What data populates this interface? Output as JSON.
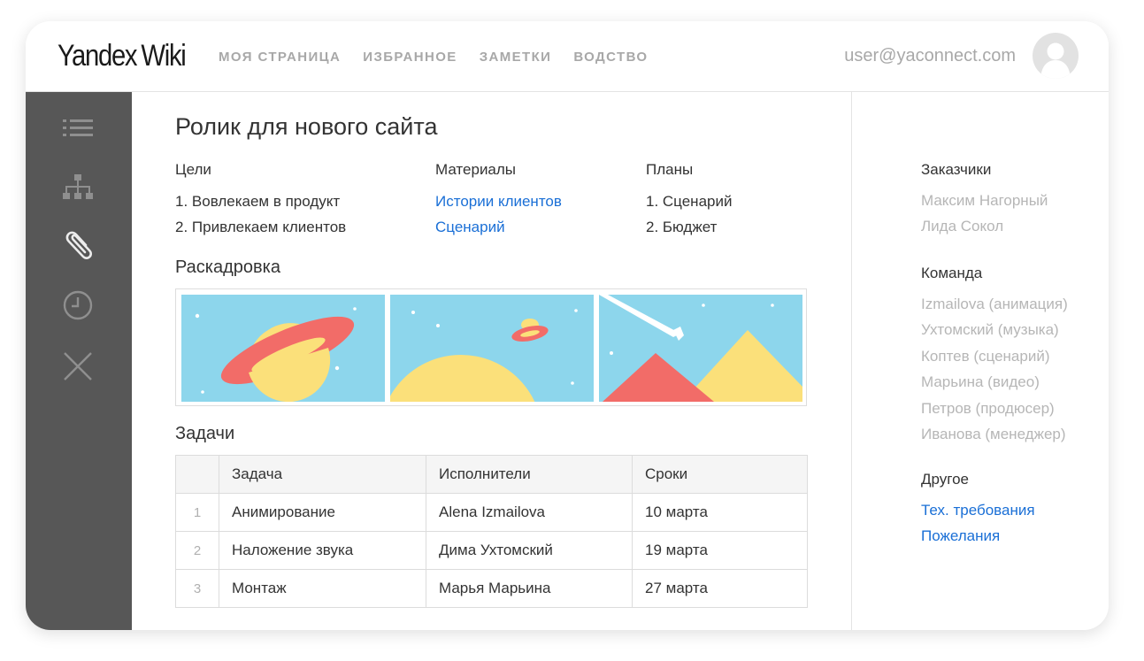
{
  "header": {
    "logo_brand": "Yandex",
    "logo_product": "Wiki",
    "nav": [
      "МОЯ СТРАНИЦА",
      "ИЗБРАННОЕ",
      "ЗАМЕТКИ",
      "ВОДСТВО"
    ],
    "user_email": "user@yaconnect.com"
  },
  "sidebar": {
    "icons": [
      "list-icon",
      "structure-icon",
      "paperclip-icon",
      "clock-icon",
      "close-icon"
    ]
  },
  "page": {
    "title": "Ролик для нового сайта",
    "goals": {
      "title": "Цели",
      "items": [
        "1. Вовлекаем в продукт",
        "2. Привлекаем клиентов"
      ]
    },
    "materials": {
      "title": "Материалы",
      "links": [
        "Истории клиентов",
        "Сценарий"
      ]
    },
    "plans": {
      "title": "Планы",
      "items": [
        "1. Сценарий",
        "2. Бюджет"
      ]
    },
    "storyboard_title": "Раскадровка",
    "tasks_title": "Задачи",
    "tasks_table": {
      "headers": [
        "",
        "Задача",
        "Исполнители",
        "Сроки"
      ],
      "rows": [
        [
          "1",
          "Анимирование",
          "Alena Izmailova",
          "10 марта"
        ],
        [
          "2",
          "Наложение звука",
          "Дима Ухтомский",
          "19 марта"
        ],
        [
          "3",
          "Монтаж",
          "Марья Марьина",
          "27 марта"
        ]
      ]
    }
  },
  "right_panel": {
    "customers_title": "Заказчики",
    "customers": [
      "Максим Нагорный",
      "Лида Сокол"
    ],
    "team_title": "Команда",
    "team": [
      "Izmailova (анимация)",
      "Ухтомский (музыка)",
      "Коптев (сценарий)",
      "Марьина (видео)",
      "Петров (продюсер)",
      "Иванова (менеджер)"
    ],
    "other_title": "Другое",
    "other_links": [
      "Тех. требования",
      "Пожелания"
    ]
  },
  "colors": {
    "sky": "#8dd6ec",
    "yellow": "#fbe07a",
    "coral": "#f26c68",
    "sidebar": "#575757",
    "link": "#1a6fd6"
  }
}
